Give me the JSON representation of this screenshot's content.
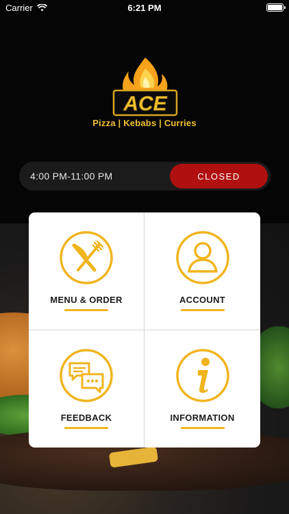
{
  "status_bar": {
    "carrier": "Carrier",
    "time": "6:21 PM"
  },
  "brand": {
    "logo_text": "ACE",
    "tagline": "Pizza | Kebabs | Curries",
    "accent_color": "#f2c232"
  },
  "hours": {
    "text": "4:00 PM-11:00 PM",
    "status": "CLOSED",
    "status_color": "#b01010"
  },
  "menu": {
    "tiles": [
      {
        "label": "MENU & ORDER",
        "icon": "fork-knife-icon"
      },
      {
        "label": "ACCOUNT",
        "icon": "user-icon"
      },
      {
        "label": "FEEDBACK",
        "icon": "chat-bubbles-icon"
      },
      {
        "label": "INFORMATION",
        "icon": "info-icon"
      }
    ],
    "icon_color": "#f0b41c"
  }
}
